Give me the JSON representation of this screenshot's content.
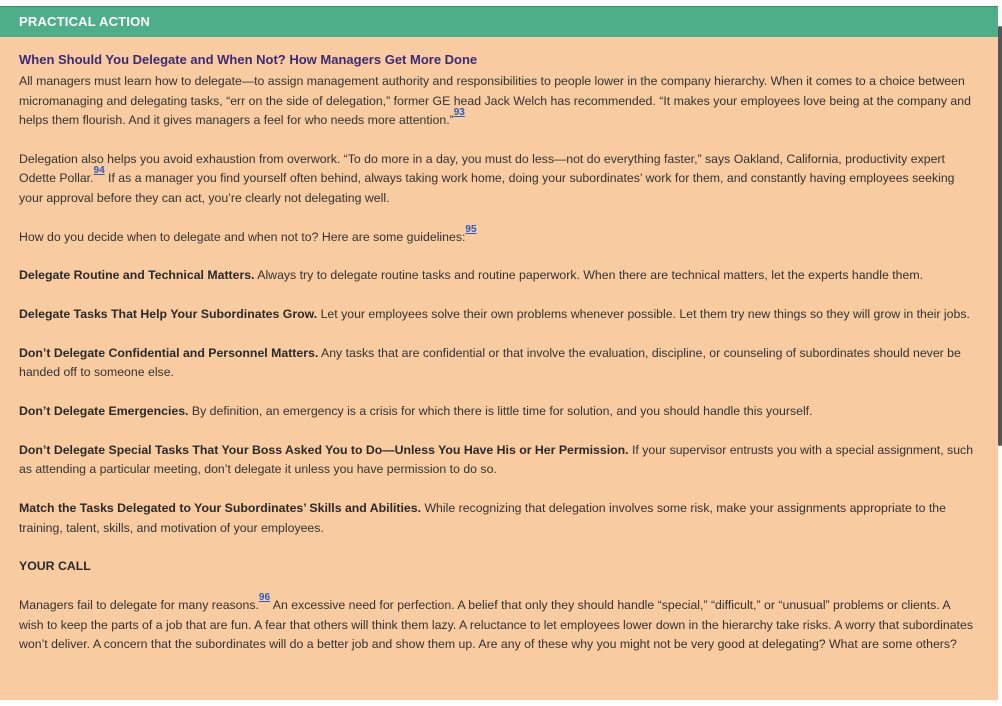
{
  "header": {
    "label": "PRACTICAL ACTION"
  },
  "article": {
    "title": "When Should You Delegate and When Not? How Managers Get More Done",
    "p1": "All managers must learn how to delegate—to assign management authority and responsibilities to people lower in the company hierarchy. When it comes to a choice between micromanaging and delegating tasks, “err on the side of delegation,” former GE head Jack Welch has recommended. “It makes your employees love being at the company and helps them flourish. And it gives managers a feel for who needs more attention.”",
    "fn93": "93",
    "p2a": "Delegation also helps you avoid exhaustion from overwork. “To do more in a day, you must do less—not do everything faster,” says Oakland, California, productivity expert Odette Pollar.",
    "fn94": "94",
    "p2b": " If as a manager you find yourself often behind, always taking work home, doing your subordinates’ work for them, and constantly having employees seeking your approval before they can act, you’re clearly not delegating well.",
    "p3": "How do you decide when to delegate and when not to? Here are some guidelines:",
    "fn95": "95",
    "g1_title": "Delegate Routine and Technical Matters.",
    "g1_text": " Always try to delegate routine tasks and routine paperwork. When there are technical matters, let the experts handle them.",
    "g2_title": "Delegate Tasks That Help Your Subordinates Grow.",
    "g2_text": " Let your employees solve their own problems whenever possible. Let them try new things so they will grow in their jobs.",
    "g3_title": "Don’t Delegate Confidential and Personnel Matters.",
    "g3_text": " Any tasks that are confidential or that involve the evaluation, discipline, or counseling of subordinates should never be handed off to someone else.",
    "g4_title": "Don’t Delegate Emergencies.",
    "g4_text": " By definition, an emergency is a crisis for which there is little time for solution, and you should handle this yourself.",
    "g5_title": "Don’t Delegate Special Tasks That Your Boss Asked You to Do—Unless You Have His or Her Permission.",
    "g5_text": " If your supervisor entrusts you with a special assignment, such as attending a particular meeting, don’t delegate it unless you have permission to do so.",
    "g6_title": "Match the Tasks Delegated to Your Subordinates’ Skills and Abilities.",
    "g6_text": " While recognizing that delegation involves some risk, make your assignments appropriate to the training, talent, skills, and motivation of your employees.",
    "yourcall": "YOUR CALL",
    "p4a": "Managers fail to delegate for many reasons.",
    "fn96": "96",
    "p4b": " An excessive need for perfection. A belief that only they should handle “special,” “difficult,” or “unusual” problems or clients. A wish to keep the parts of a job that are fun. A fear that others will think them lazy. A reluctance to let employees lower down in the hierarchy take risks. A worry that subordinates won’t deliver. A concern that the subordinates will do a better job and show them up. Are any of these why you might not be very good at delegating? What are some others?"
  },
  "colors": {
    "header_bg": "#4daf8a",
    "box_bg": "#f8cba0",
    "title_color": "#3a2a7a",
    "link_color": "#2b5bc4"
  }
}
